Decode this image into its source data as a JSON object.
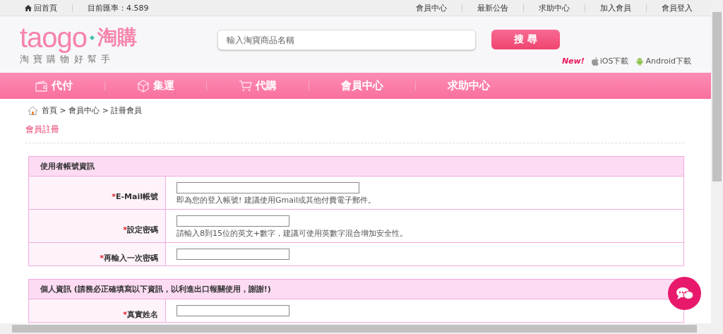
{
  "top_bar": {
    "home_link": "回首頁",
    "rate": "目前匯率：4.589",
    "links": [
      "會員中心",
      "最新公告",
      "求助中心",
      "加入會員",
      "會員登入"
    ]
  },
  "header": {
    "logo": "taogo",
    "logo_cn": "淘購",
    "tagline": "淘 寶 購 物 好 幫 手",
    "search": {
      "placeholder": "輸入淘寶商品名稱"
    },
    "search_button": "搜 尋",
    "new_badge": "New!",
    "apps": [
      {
        "kind": "ios",
        "label": "iOS下載"
      },
      {
        "kind": "android",
        "label": "Android下載"
      }
    ]
  },
  "nav": [
    {
      "kind": "wallet",
      "label": "代付"
    },
    {
      "kind": "box",
      "label": "集運"
    },
    {
      "kind": "cart",
      "label": "代購"
    },
    {
      "kind": "none",
      "label": "會員中心"
    },
    {
      "kind": "none",
      "label": "求助中心"
    }
  ],
  "breadcrumb": "首頁 > 會員中心 > 註冊會員",
  "page_title": "會員註冊",
  "sections": [
    {
      "title": "使用者帳號資訊",
      "rows": [
        {
          "mark": "*",
          "label": "E-Mail帳號",
          "wide": true,
          "hint": "即為您的登入帳號! 建議使用Gmail或其他付費電子郵件。"
        },
        {
          "mark": "*",
          "label": "設定密碼",
          "wide": false,
          "hint": "請輸入8到15位的英文+數字，建議可使用英數字混合增加安全性。"
        },
        {
          "mark": "*",
          "label": "再輸入一次密碼",
          "wide": false
        }
      ]
    },
    {
      "title": "個人資訊 (請務必正確填寫以下資訊，以利進出口報關使用，謝謝!)",
      "rows": [
        {
          "mark": "*",
          "label": "真實姓名",
          "wide": false
        }
      ]
    }
  ]
}
